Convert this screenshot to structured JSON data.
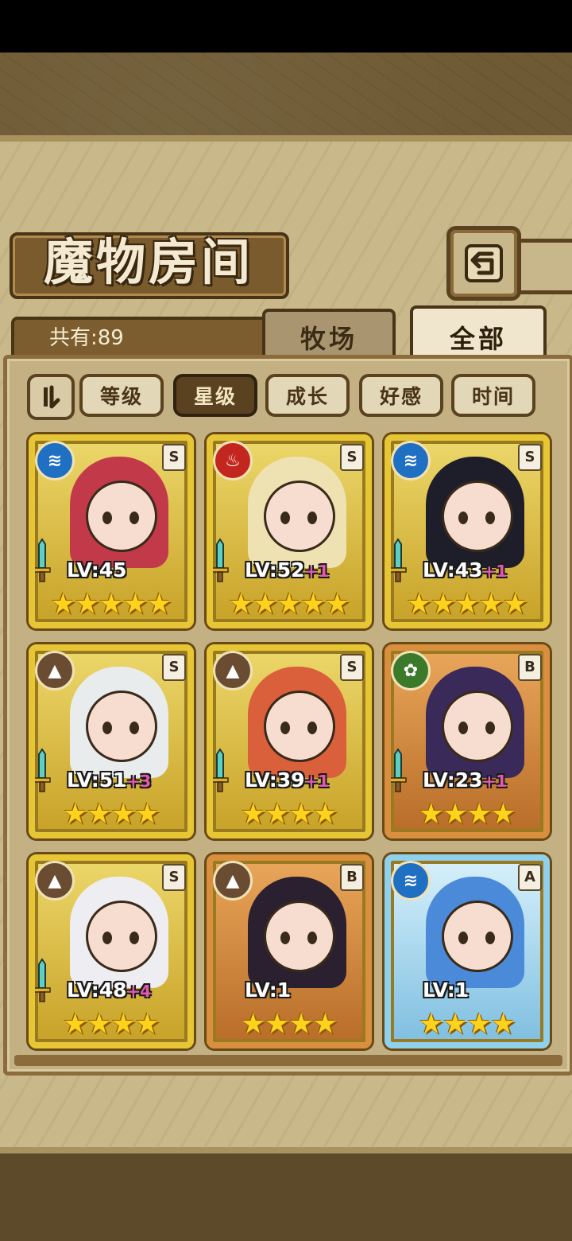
{
  "header": {
    "title": "魔物房间",
    "back_icon": "back-arrow-icon",
    "count_label": "共有:89"
  },
  "tabs": [
    {
      "label": "牧场",
      "active": false
    },
    {
      "label": "全部",
      "active": true
    }
  ],
  "sort": {
    "toggle_icon": "sort-order-icon",
    "buttons": [
      {
        "label": "等级",
        "active": false
      },
      {
        "label": "星级",
        "active": true
      },
      {
        "label": "成长",
        "active": false
      },
      {
        "label": "好感",
        "active": false
      },
      {
        "label": "时间",
        "active": false
      }
    ]
  },
  "colors": {
    "gold_frame": "#e6c635",
    "bronze_frame": "#d98f3e",
    "ice_frame": "#8fd0ec",
    "level_plus": "#e25ab0",
    "star": "#ffd21c"
  },
  "monsters": [
    {
      "element": "water",
      "element_icon": "water-element-icon",
      "rank": "S",
      "level": "LV:45",
      "plus": "",
      "stars": 5,
      "frame": "gold",
      "has_weapon": true,
      "hair": "#c23a4a"
    },
    {
      "element": "fire",
      "element_icon": "fire-element-icon",
      "rank": "S",
      "level": "LV:52",
      "plus": "+1",
      "stars": 5,
      "frame": "gold",
      "has_weapon": true,
      "hair": "#efe2b2"
    },
    {
      "element": "water",
      "element_icon": "water-element-icon",
      "rank": "S",
      "level": "LV:43",
      "plus": "+1",
      "stars": 5,
      "frame": "gold",
      "has_weapon": true,
      "hair": "#1e1e2a"
    },
    {
      "element": "earth",
      "element_icon": "earth-element-icon",
      "rank": "S",
      "level": "LV:51",
      "plus": "+3",
      "stars": 4,
      "frame": "gold",
      "has_weapon": true,
      "hair": "#e8ecec"
    },
    {
      "element": "earth",
      "element_icon": "earth-element-icon",
      "rank": "S",
      "level": "LV:39",
      "plus": "+1",
      "stars": 4,
      "frame": "gold",
      "has_weapon": true,
      "hair": "#d9603a"
    },
    {
      "element": "wind",
      "element_icon": "wind-element-icon",
      "rank": "B",
      "level": "LV:23",
      "plus": "+1",
      "stars": 4,
      "frame": "bronze",
      "has_weapon": true,
      "hair": "#3a2a5a"
    },
    {
      "element": "earth",
      "element_icon": "earth-element-icon",
      "rank": "S",
      "level": "LV:48",
      "plus": "+4",
      "stars": 4,
      "frame": "gold",
      "has_weapon": true,
      "hair": "#eeeef2"
    },
    {
      "element": "earth",
      "element_icon": "earth-element-icon",
      "rank": "B",
      "level": "LV:1",
      "plus": "",
      "stars": 4,
      "frame": "bronze",
      "has_weapon": false,
      "hair": "#2a2030"
    },
    {
      "element": "water",
      "element_icon": "water-element-icon",
      "rank": "A",
      "level": "LV:1",
      "plus": "",
      "stars": 4,
      "frame": "ice",
      "has_weapon": false,
      "hair": "#4a8ad8"
    }
  ]
}
